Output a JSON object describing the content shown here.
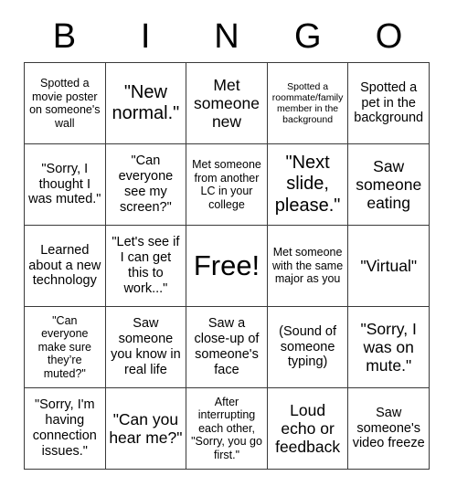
{
  "card": {
    "header_letters": [
      "B",
      "I",
      "N",
      "G",
      "O"
    ],
    "grid_size": "5x5",
    "border_color": "#3a3a3a",
    "background_color": "#ffffff",
    "text_color": "#000000",
    "rows": [
      [
        {
          "text": "Spotted a movie poster on someone's wall",
          "size": "s",
          "marked": false
        },
        {
          "text": "\"New normal.\"",
          "size": "xl",
          "marked": false
        },
        {
          "text": "Met someone new",
          "size": "l",
          "marked": false
        },
        {
          "text": "Spotted a roommate/family member in the background",
          "size": "xs",
          "marked": false
        },
        {
          "text": "Spotted a pet in the background",
          "size": "m",
          "marked": false
        }
      ],
      [
        {
          "text": "\"Sorry, I thought I was muted.\"",
          "size": "m",
          "marked": false
        },
        {
          "text": "\"Can everyone see my screen?\"",
          "size": "m",
          "marked": false
        },
        {
          "text": "Met someone from another LC in your college",
          "size": "s",
          "marked": false
        },
        {
          "text": "\"Next slide, please.\"",
          "size": "xl",
          "marked": false
        },
        {
          "text": "Saw someone eating",
          "size": "l",
          "marked": false
        }
      ],
      [
        {
          "text": "Learned about a new technology",
          "size": "m",
          "marked": false
        },
        {
          "text": "\"Let's see if I can get this to work...\"",
          "size": "m",
          "marked": false
        },
        {
          "text": "Free!",
          "size": "free",
          "marked": false
        },
        {
          "text": "Met someone with the same major as you",
          "size": "s",
          "marked": false
        },
        {
          "text": "\"Virtual\"",
          "size": "l",
          "marked": false
        }
      ],
      [
        {
          "text": "\"Can everyone make sure they’re muted?\"",
          "size": "s",
          "marked": false
        },
        {
          "text": "Saw someone you know in real life",
          "size": "m",
          "marked": false
        },
        {
          "text": "Saw a close-up of someone's face",
          "size": "m",
          "marked": false
        },
        {
          "text": "(Sound of someone typing)",
          "size": "m",
          "marked": false
        },
        {
          "text": "\"Sorry, I was on mute.\"",
          "size": "l",
          "marked": false
        }
      ],
      [
        {
          "text": "\"Sorry, I'm having connection issues.\"",
          "size": "m",
          "marked": false
        },
        {
          "text": "\"Can you hear me?\"",
          "size": "l",
          "marked": false
        },
        {
          "text": "After interrupting each other, \"Sorry, you go first.\"",
          "size": "s",
          "marked": false
        },
        {
          "text": "Loud echo or feedback",
          "size": "l",
          "marked": false
        },
        {
          "text": "Saw someone's video freeze",
          "size": "m",
          "marked": false
        }
      ]
    ]
  }
}
